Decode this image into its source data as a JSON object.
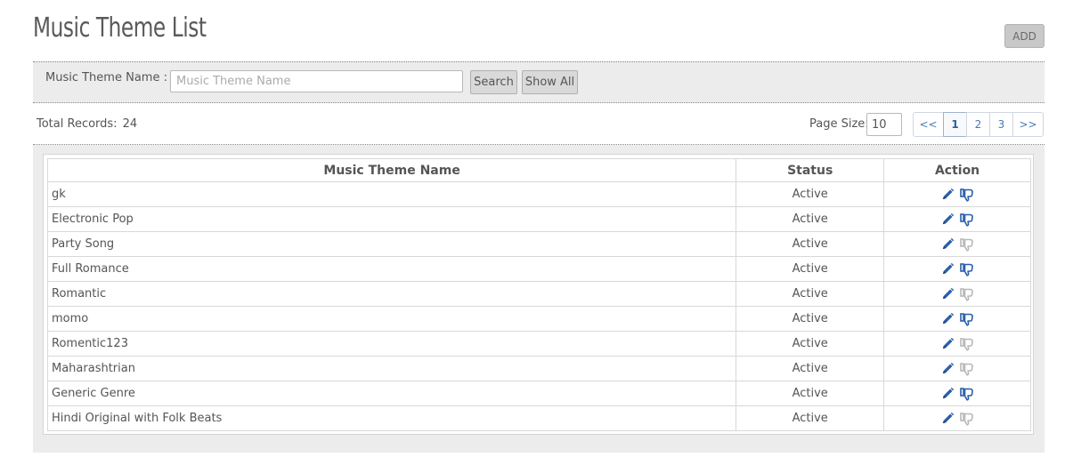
{
  "header": {
    "title": "Music Theme List",
    "add_label": "ADD"
  },
  "search": {
    "label": "Music Theme Name :",
    "placeholder": "Music Theme Name",
    "value": "",
    "search_label": "Search",
    "show_all_label": "Show All"
  },
  "summary": {
    "total_label": "Total Records:",
    "total_value": "24",
    "page_size_label": "Page Size:",
    "page_size_value": "10"
  },
  "pagination": {
    "prev": "<<",
    "pages": [
      "1",
      "2",
      "3"
    ],
    "current": "1",
    "next": ">>"
  },
  "table": {
    "columns": [
      "Music Theme Name",
      "Status",
      "Action"
    ],
    "rows": [
      {
        "name": "gk",
        "status": "Active",
        "dislike_active": true
      },
      {
        "name": "Electronic Pop",
        "status": "Active",
        "dislike_active": true
      },
      {
        "name": "Party Song",
        "status": "Active",
        "dislike_active": false
      },
      {
        "name": "Full Romance",
        "status": "Active",
        "dislike_active": true
      },
      {
        "name": "Romantic",
        "status": "Active",
        "dislike_active": false
      },
      {
        "name": "momo",
        "status": "Active",
        "dislike_active": true
      },
      {
        "name": "Romentic123",
        "status": "Active",
        "dislike_active": false
      },
      {
        "name": "Maharashtrian",
        "status": "Active",
        "dislike_active": false
      },
      {
        "name": "Generic Genre",
        "status": "Active",
        "dislike_active": true
      },
      {
        "name": "Hindi Original with Folk Beats",
        "status": "Active",
        "dislike_active": false
      }
    ],
    "icons": {
      "edit": "pencil-icon",
      "toggle": "thumbs-down-icon"
    }
  },
  "colors": {
    "icon_active": "#2a5ea8",
    "icon_inactive": "#b8b8b8",
    "panel_bg": "#ececec",
    "link": "#4a7ab5"
  }
}
